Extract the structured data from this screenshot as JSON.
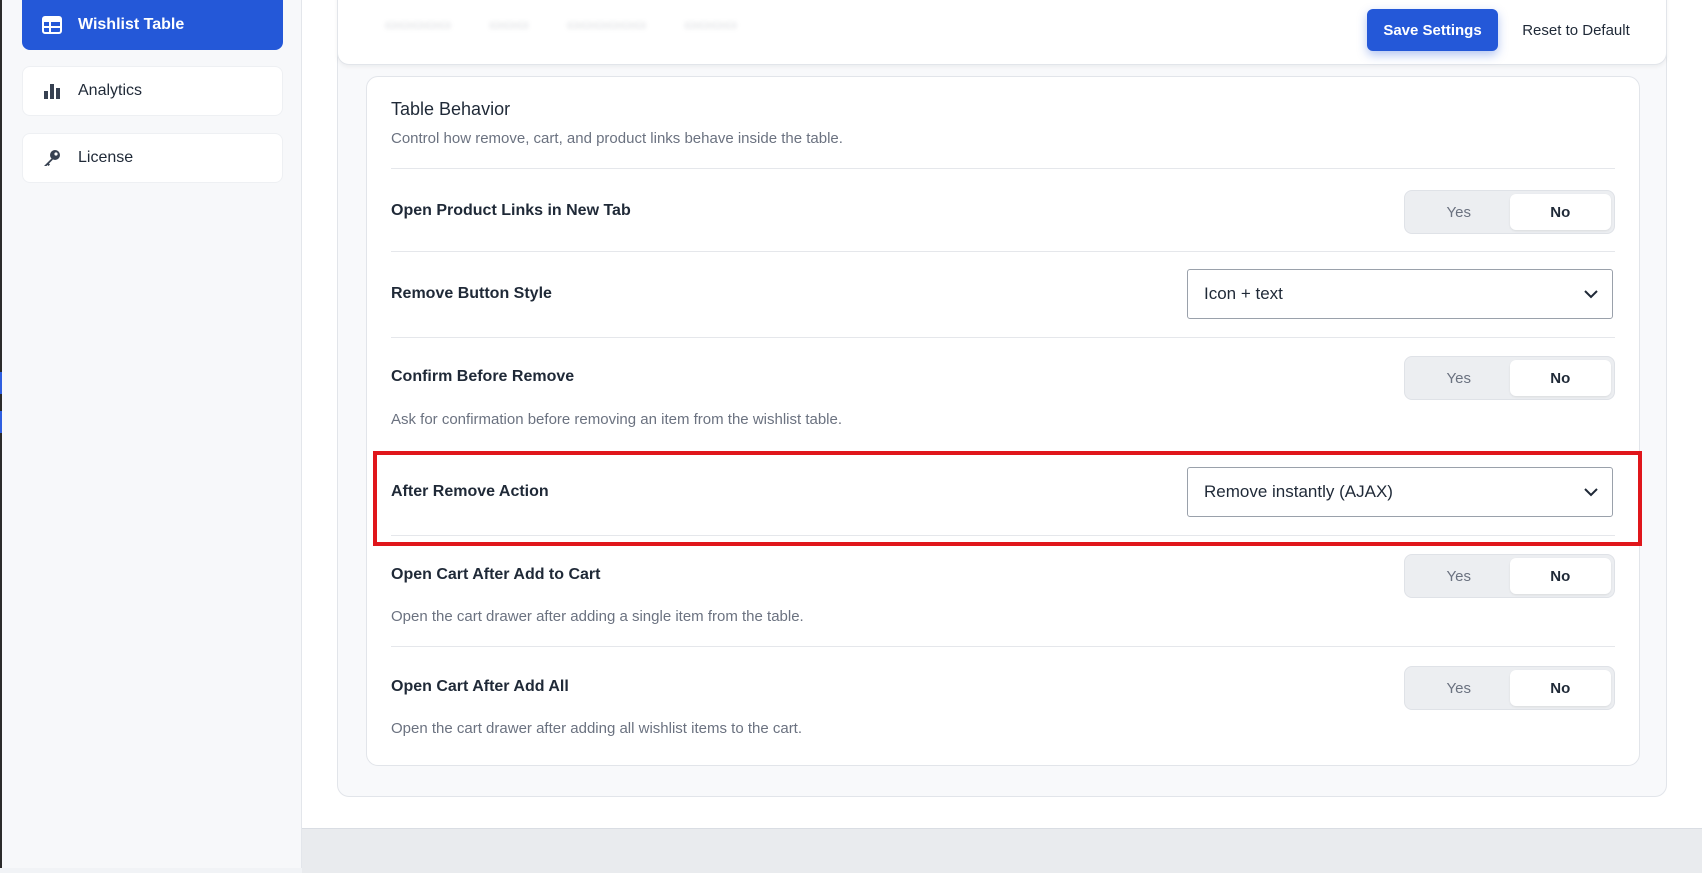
{
  "sidebar": {
    "items": [
      {
        "label": "Wishlist Table",
        "icon": "table-icon",
        "active": true
      },
      {
        "label": "Analytics",
        "icon": "bar-chart-icon",
        "active": false
      },
      {
        "label": "License",
        "icon": "key-icon",
        "active": false
      }
    ]
  },
  "toolbar": {
    "save_label": "Save Settings",
    "reset_label": "Reset to Default"
  },
  "section": {
    "title": "Table Behavior",
    "description": "Control how remove, cart, and product links behave inside the table."
  },
  "settings": {
    "open_links": {
      "label": "Open Product Links in New Tab",
      "value": "No",
      "options": [
        "Yes",
        "No"
      ]
    },
    "remove_style": {
      "label": "Remove Button Style",
      "value": "Icon + text"
    },
    "confirm_remove": {
      "label": "Confirm Before Remove",
      "help": "Ask for confirmation before removing an item from the wishlist table.",
      "value": "No",
      "options": [
        "Yes",
        "No"
      ]
    },
    "after_remove": {
      "label": "After Remove Action",
      "value": "Remove instantly (AJAX)"
    },
    "open_cart_add": {
      "label": "Open Cart After Add to Cart",
      "help": "Open the cart drawer after adding a single item from the table.",
      "value": "No",
      "options": [
        "Yes",
        "No"
      ]
    },
    "open_cart_add_all": {
      "label": "Open Cart After Add All",
      "help": "Open the cart drawer after adding all wishlist items to the cart.",
      "value": "No",
      "options": [
        "Yes",
        "No"
      ]
    }
  },
  "colors": {
    "accent": "#2458d8",
    "highlight": "#e0161b"
  }
}
